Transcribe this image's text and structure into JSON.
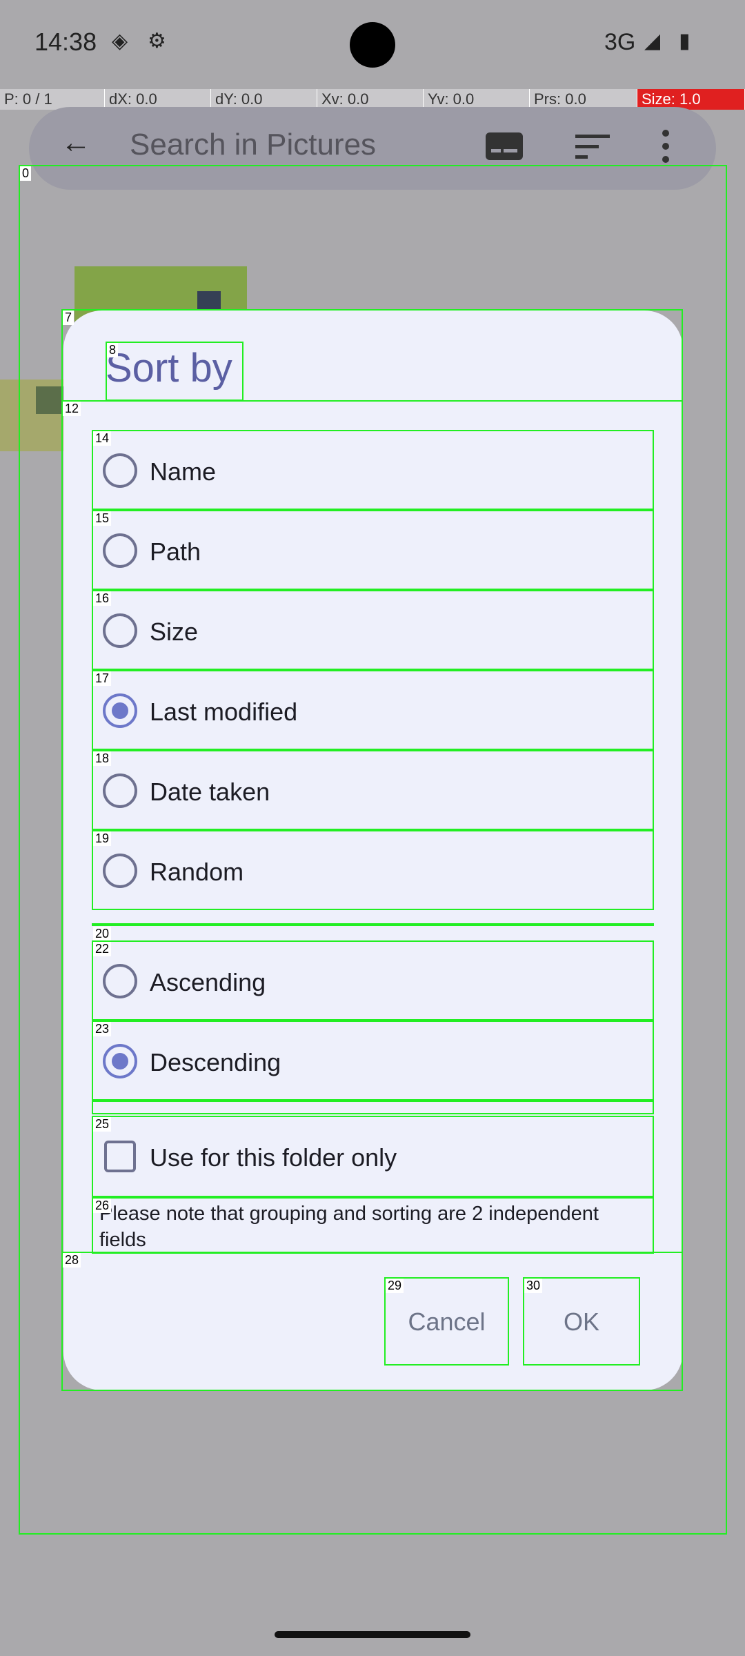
{
  "status_bar": {
    "time": "14:38",
    "network": "3G",
    "icons": [
      "location-icon",
      "settings-icon",
      "signal-icon",
      "battery-icon"
    ]
  },
  "pointer_info": {
    "p": "P: 0 / 1",
    "dx": "dX: 0.0",
    "dy": "dY: 0.0",
    "xv": "Xv: 0.0",
    "yv": "Yv: 0.0",
    "prs": "Prs: 0.0",
    "size": "Size: 1.0"
  },
  "app_bar": {
    "search_placeholder": "Search in Pictures",
    "icons": [
      "back-arrow-icon",
      "subtitle-icon",
      "sort-icon",
      "more-vert-icon"
    ]
  },
  "dialog": {
    "title": "Sort by",
    "sort_options": [
      {
        "label": "Name",
        "checked": false
      },
      {
        "label": "Path",
        "checked": false
      },
      {
        "label": "Size",
        "checked": false
      },
      {
        "label": "Last modified",
        "checked": true
      },
      {
        "label": "Date taken",
        "checked": false
      },
      {
        "label": "Random",
        "checked": false
      }
    ],
    "order_options": [
      {
        "label": "Ascending",
        "checked": false
      },
      {
        "label": "Descending",
        "checked": true
      }
    ],
    "folder_only_label": "Use for this folder only",
    "folder_only_checked": false,
    "note": "Please note that grouping and sorting are 2 independent fields",
    "cancel_label": "Cancel",
    "ok_label": "OK"
  },
  "overlay_ids": [
    "0",
    "7",
    "8",
    "12",
    "14",
    "15",
    "16",
    "17",
    "18",
    "19",
    "20",
    "22",
    "23",
    "25",
    "26",
    "28",
    "29",
    "30"
  ],
  "colors": {
    "accent": "#6d78c9",
    "overlay_outline": "#22ee22",
    "debug_size_bg": "#e02020"
  }
}
